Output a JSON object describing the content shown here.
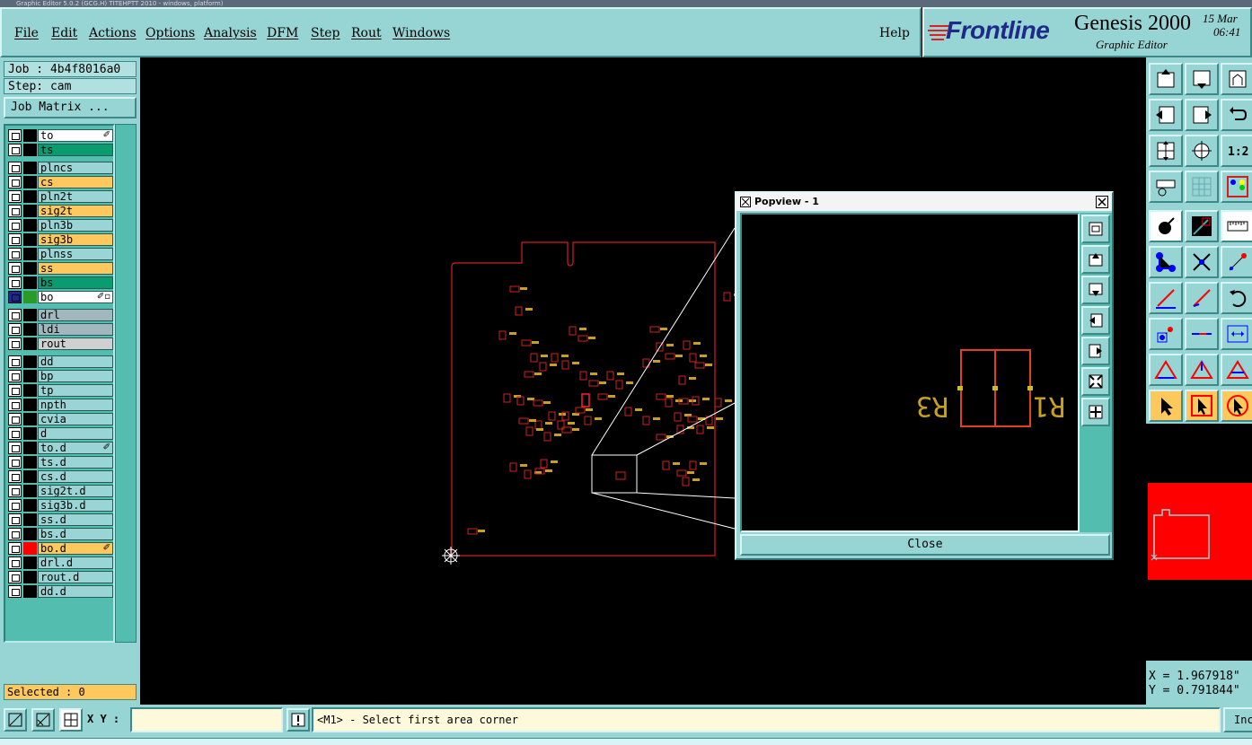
{
  "window": {
    "title": "Graphic Editor 5.0.2 (GCG.H) TITEHPTT 2010 - windows, platform)"
  },
  "menu": {
    "file": "File",
    "edit": "Edit",
    "actions": "Actions",
    "options": "Options",
    "analysis": "Analysis",
    "dfm": "DFM",
    "step": "Step",
    "rout": "Rout",
    "windows": "Windows",
    "help": "Help"
  },
  "brand": {
    "logo": "Frontline",
    "product": "Genesis 2000",
    "subtitle": "Graphic Editor",
    "date": "15 Mar",
    "time": "06:41"
  },
  "job": {
    "job_label": "Job : 4b4f8016a0",
    "step_label": "Step: cam",
    "matrix_button": "Job Matrix ..."
  },
  "layers": [
    {
      "name": "to",
      "color": "#ffffff",
      "mark": "✐"
    },
    {
      "name": "ts",
      "color": "#0a9b6e"
    },
    {
      "name": "plncs",
      "color": "#9ad4d4"
    },
    {
      "name": "cs",
      "color": "#ffc85c"
    },
    {
      "name": "pln2t",
      "color": "#9ad4d4"
    },
    {
      "name": "sig2t",
      "color": "#ffc85c"
    },
    {
      "name": "pln3b",
      "color": "#9ad4d4"
    },
    {
      "name": "sig3b",
      "color": "#ffc85c"
    },
    {
      "name": "plnss",
      "color": "#9ad4d4"
    },
    {
      "name": "ss",
      "color": "#ffc85c"
    },
    {
      "name": "bs",
      "color": "#0a9b6e"
    },
    {
      "name": "bo",
      "color": "#ffffff",
      "mark": "✐▫",
      "active": true
    },
    {
      "name": "drl",
      "color": "#a2b6be"
    },
    {
      "name": "ldi",
      "color": "#a2b6be"
    },
    {
      "name": "rout",
      "color": "#d0d0d0"
    },
    {
      "name": "dd",
      "color": "#9ad4d4"
    },
    {
      "name": "bp",
      "color": "#9ad4d4"
    },
    {
      "name": "tp",
      "color": "#9ad4d4"
    },
    {
      "name": "npth",
      "color": "#9ad4d4"
    },
    {
      "name": "cvia",
      "color": "#9ad4d4"
    },
    {
      "name": "d",
      "color": "#9ad4d4"
    },
    {
      "name": "to.d",
      "color": "#9ad4d4",
      "mark": "✐"
    },
    {
      "name": "ts.d",
      "color": "#9ad4d4"
    },
    {
      "name": "cs.d",
      "color": "#9ad4d4"
    },
    {
      "name": "sig2t.d",
      "color": "#9ad4d4"
    },
    {
      "name": "sig3b.d",
      "color": "#9ad4d4"
    },
    {
      "name": "ss.d",
      "color": "#9ad4d4"
    },
    {
      "name": "bs.d",
      "color": "#9ad4d4"
    },
    {
      "name": "bo.d",
      "color": "#ffc85c",
      "mark": "✐",
      "red": true
    },
    {
      "name": "drl.d",
      "color": "#9ad4d4"
    },
    {
      "name": "rout.d",
      "color": "#9ad4d4"
    },
    {
      "name": "dd.d",
      "color": "#9ad4d4"
    }
  ],
  "selected": "Selected : 0",
  "popview": {
    "title": "Popview - 1",
    "close_label": "Close",
    "label_left": "R3",
    "label_right": "R1"
  },
  "coords": {
    "x": "X = 1.967918\"",
    "y": "Y = 0.791844\""
  },
  "status": {
    "xy_label": "X Y :",
    "xy_value": "",
    "message": "<M1> - Select first area corner",
    "inc_label": "Inc"
  },
  "colors": {
    "panel": "#97d4d4",
    "board_outline": "#d22020",
    "component": "#c8a020",
    "accent_red": "#ff0000"
  }
}
